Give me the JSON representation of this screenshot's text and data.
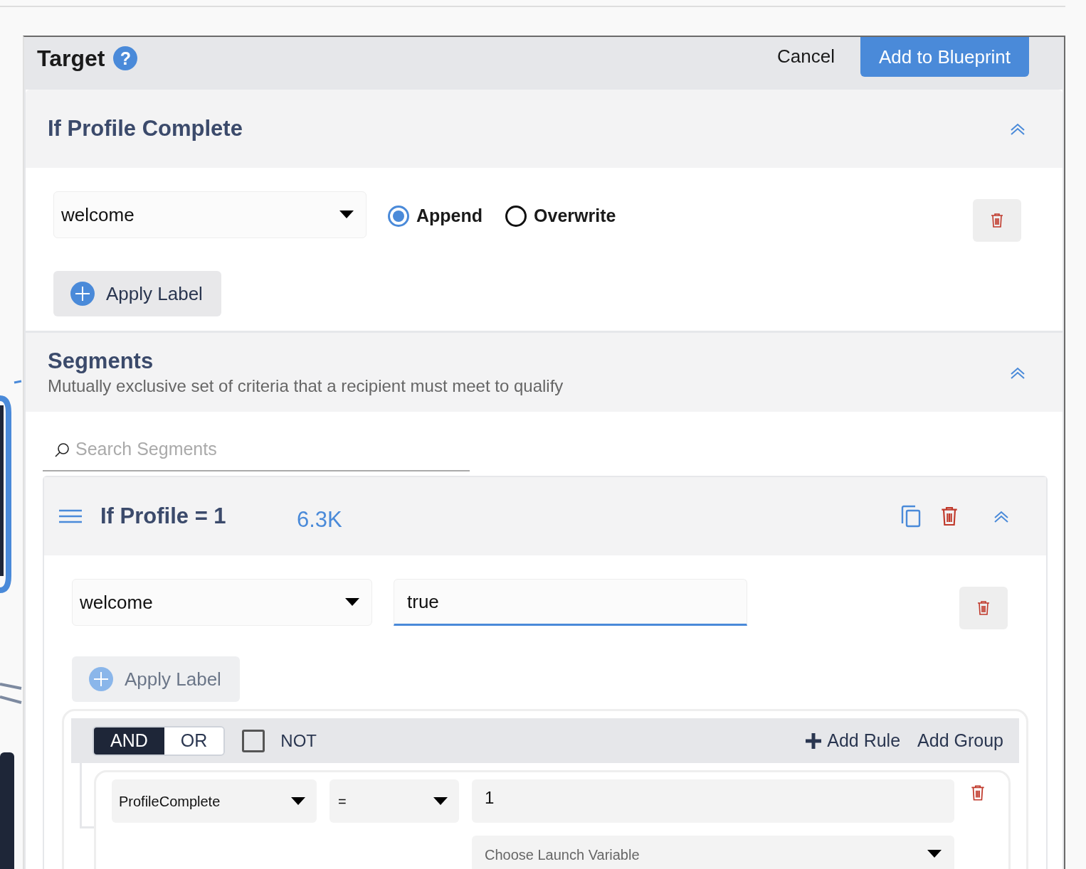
{
  "dialog": {
    "title": "Target",
    "help": "?",
    "cancel": "Cancel",
    "confirm": "Add to Blueprint"
  },
  "label_section": {
    "title": "If Profile Complete",
    "expanded": true,
    "label_select": "welcome",
    "modes": [
      {
        "label": "Append",
        "selected": true
      },
      {
        "label": "Overwrite",
        "selected": false
      }
    ],
    "apply_label": {
      "text": "Apply Label",
      "disabled": false
    }
  },
  "segments_section": {
    "title": "Segments",
    "subtitle": "Mutually exclusive set of criteria that a recipient must meet to qualify",
    "expanded": true,
    "search": {
      "placeholder": "Search Segments"
    },
    "segments": [
      {
        "title": "If Profile = 1",
        "count": "6.3K",
        "expanded": true,
        "label_select": "welcome",
        "label_value": "true",
        "apply_label": {
          "text": "Apply Label",
          "disabled": true
        },
        "query": {
          "combinators": [
            {
              "label": "AND",
              "selected": true
            },
            {
              "label": "OR",
              "selected": false
            }
          ],
          "not": {
            "label": "NOT",
            "checked": false
          },
          "add_rule": "Add Rule",
          "add_group": "Add Group",
          "rules": [
            {
              "field": "ProfileComplete",
              "operator": "=",
              "value": "1",
              "variable_placeholder": "Choose Launch Variable"
            }
          ]
        }
      }
    ]
  }
}
